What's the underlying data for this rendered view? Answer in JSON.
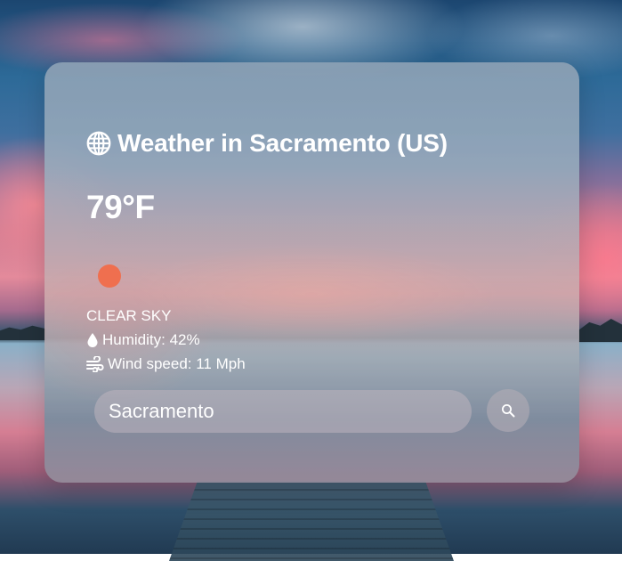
{
  "weather": {
    "title": "Weather in Sacramento (US)",
    "temperature": "79°F",
    "condition": "CLEAR SKY",
    "humidity": "Humidity: 42%",
    "wind": "Wind speed: 11 Mph",
    "condition_icon_color": "#ef6f4f"
  },
  "search": {
    "value": "Sacramento",
    "button_icon": "search-icon"
  },
  "icons": {
    "title": "globe-icon",
    "humidity": "droplet-icon",
    "wind": "wind-icon",
    "condition": "sun-icon"
  }
}
